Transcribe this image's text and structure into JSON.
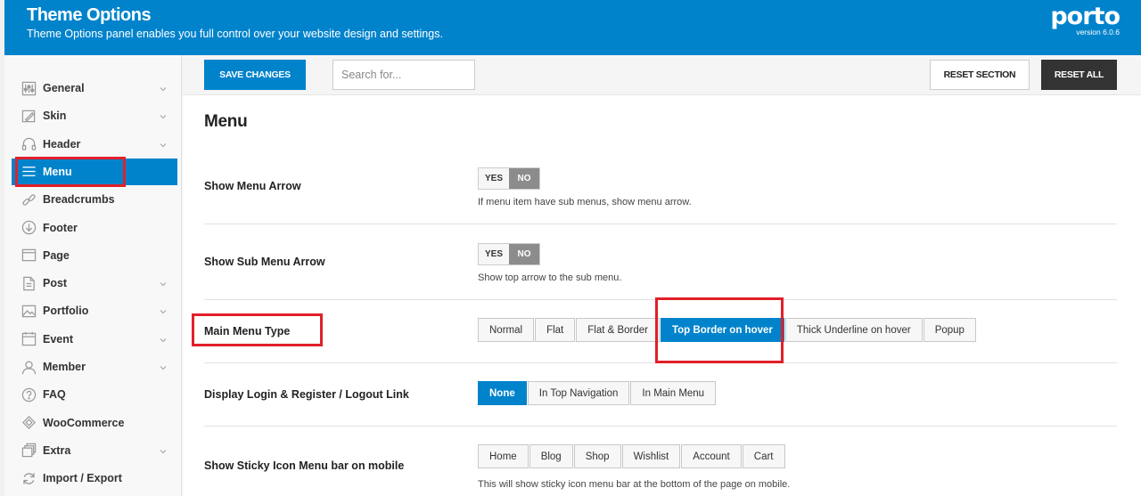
{
  "header": {
    "title": "Theme Options",
    "subtitle": "Theme Options panel enables you full control over your website design and settings.",
    "logo_text": "porto",
    "version": "version 6.0.6",
    "bg_color": "#0183cc"
  },
  "sidebar": {
    "items": [
      {
        "label": "General",
        "icon": "sliders-icon",
        "has_chevron": true
      },
      {
        "label": "Skin",
        "icon": "paintbrush-icon",
        "has_chevron": true
      },
      {
        "label": "Header",
        "icon": "headphones-icon",
        "has_chevron": true
      },
      {
        "label": "Menu",
        "icon": "hamburger-icon",
        "has_chevron": false,
        "active": true
      },
      {
        "label": "Breadcrumbs",
        "icon": "link-icon",
        "has_chevron": false
      },
      {
        "label": "Footer",
        "icon": "arrow-circle-down-icon",
        "has_chevron": false
      },
      {
        "label": "Page",
        "icon": "page-icon",
        "has_chevron": false
      },
      {
        "label": "Post",
        "icon": "document-icon",
        "has_chevron": true
      },
      {
        "label": "Portfolio",
        "icon": "image-icon",
        "has_chevron": true
      },
      {
        "label": "Event",
        "icon": "calendar-icon",
        "has_chevron": true
      },
      {
        "label": "Member",
        "icon": "user-icon",
        "has_chevron": true
      },
      {
        "label": "FAQ",
        "icon": "question-icon",
        "has_chevron": false
      },
      {
        "label": "WooCommerce",
        "icon": "woo-icon",
        "has_chevron": false
      },
      {
        "label": "Extra",
        "icon": "stack-icon",
        "has_chevron": true
      },
      {
        "label": "Import / Export",
        "icon": "refresh-icon",
        "has_chevron": false
      }
    ]
  },
  "toolbar": {
    "save_label": "SAVE CHANGES",
    "search_placeholder": "Search for...",
    "reset_section_label": "RESET SECTION",
    "reset_all_label": "RESET ALL"
  },
  "section": {
    "title": "Menu",
    "show_menu_arrow": {
      "label": "Show Menu Arrow",
      "yes": "YES",
      "no": "NO",
      "value": "NO",
      "description": "If menu item have sub menus, show menu arrow."
    },
    "show_sub_menu_arrow": {
      "label": "Show Sub Menu Arrow",
      "yes": "YES",
      "no": "NO",
      "value": "NO",
      "description": "Show top arrow to the sub menu."
    },
    "main_menu_type": {
      "label": "Main Menu Type",
      "options": [
        "Normal",
        "Flat",
        "Flat & Border",
        "Top Border on hover",
        "Thick Underline on hover",
        "Popup"
      ],
      "selected": "Top Border on hover"
    },
    "login_register": {
      "label": "Display Login & Register / Logout Link",
      "options": [
        "None",
        "In Top Navigation",
        "In Main Menu"
      ],
      "selected": "None"
    },
    "sticky_icon_menu": {
      "label": "Show Sticky Icon Menu bar on mobile",
      "options": [
        "Home",
        "Blog",
        "Shop",
        "Wishlist",
        "Account",
        "Cart"
      ],
      "description": "This will show sticky icon menu bar at the bottom of the page on mobile."
    }
  },
  "colors": {
    "accent": "#0183cc",
    "highlight": "#e0202a",
    "dark_button": "#333333"
  }
}
